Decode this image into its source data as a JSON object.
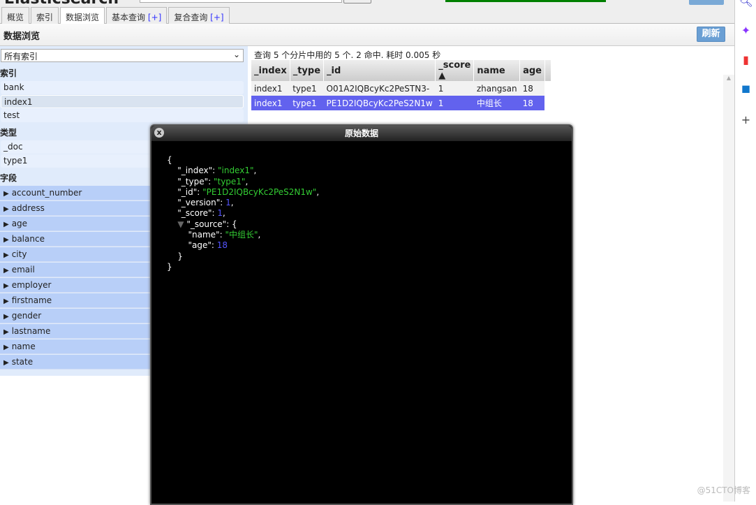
{
  "header": {
    "logo": "Elasticsearch"
  },
  "tabs": [
    {
      "label": "概览"
    },
    {
      "label": "索引"
    },
    {
      "label": "数据浏览"
    },
    {
      "label": "基本查询",
      "plus": "[+]"
    },
    {
      "label": "复合查询",
      "plus": "[+]"
    }
  ],
  "page": {
    "title": "数据浏览",
    "refresh": "刷新"
  },
  "left": {
    "select": "所有索引",
    "index_title": "索引",
    "indices": [
      "bank",
      "index1",
      "test"
    ],
    "type_title": "类型",
    "types": [
      "_doc",
      "type1"
    ],
    "field_title": "字段",
    "fields": [
      "account_number",
      "address",
      "age",
      "balance",
      "city",
      "email",
      "employer",
      "firstname",
      "gender",
      "lastname",
      "name",
      "state"
    ]
  },
  "results": {
    "summary": "查询 5 个分片中用的 5 个. 2 命中. 耗时 0.005 秒",
    "columns": [
      "_index",
      "_type",
      "_id",
      "_score ▲",
      "name",
      "age"
    ],
    "rows": [
      [
        "index1",
        "type1",
        "O01A2IQBcyKc2PeSTN3-",
        "1",
        "zhangsan",
        "18"
      ],
      [
        "index1",
        "type1",
        "PE1D2IQBcyKc2PeS2N1w",
        "1",
        "中组长",
        "18"
      ]
    ]
  },
  "dialog": {
    "title": "原始数据",
    "close": "x",
    "json": {
      "index": "\"index1\"",
      "type": "\"type1\"",
      "id": "\"PE1D2IQBcyKc2PeS2N1w\"",
      "version": "1",
      "score": "1",
      "name": "\"中组长\"",
      "age": "18"
    }
  },
  "watermark": "@51CTO博客",
  "colors": {
    "selected_row": "#6262ee",
    "field_bg": "#b8cff8",
    "panel_bg": "#e0ebfb",
    "health": "#008000"
  }
}
